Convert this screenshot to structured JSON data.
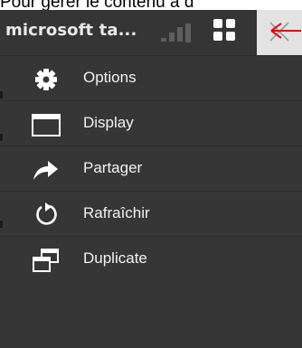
{
  "background_text": "Pour gérer le contenu à d",
  "window": {
    "title": "microsoft ta...",
    "close_symbol": "×",
    "colors": {
      "panel": "#363636",
      "close_bg": "#e3e3e3",
      "arrow": "#e00000"
    }
  },
  "menu": {
    "items": [
      {
        "label": "Options",
        "icon": "gear-icon"
      },
      {
        "label": "Display",
        "icon": "window-icon"
      },
      {
        "label": "Partager",
        "icon": "share-arrow-icon"
      },
      {
        "label": "Rafraîchir",
        "icon": "refresh-icon"
      },
      {
        "label": "Duplicate",
        "icon": "duplicate-windows-icon"
      }
    ]
  }
}
